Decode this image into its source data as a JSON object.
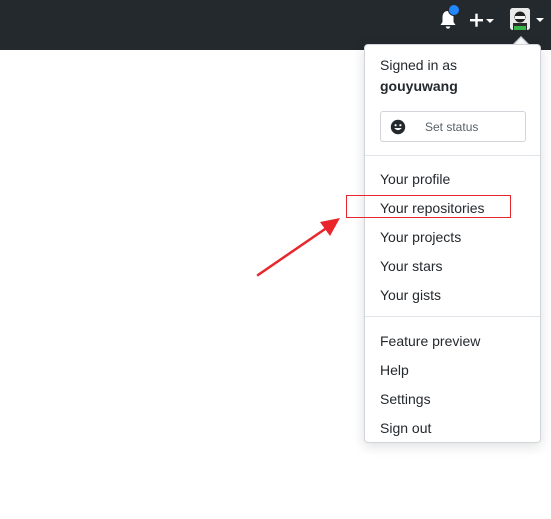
{
  "header": {
    "notifications_icon": "bell-icon",
    "notification_dot_color": "#2188ff",
    "new_icon": "plus-icon",
    "avatar_icon": "user-avatar-icon"
  },
  "dropdown": {
    "signed_in_label": "Signed in as",
    "username": "gouyuwang",
    "status_button": {
      "icon": "smiley-icon",
      "label": "Set status"
    },
    "section_one": [
      {
        "label": "Your profile"
      },
      {
        "label": "Your repositories"
      },
      {
        "label": "Your projects"
      },
      {
        "label": "Your stars"
      },
      {
        "label": "Your gists"
      }
    ],
    "section_two": [
      {
        "label": "Feature preview"
      },
      {
        "label": "Help"
      },
      {
        "label": "Settings"
      },
      {
        "label": "Sign out"
      }
    ]
  },
  "annotation": {
    "highlighted_item": "Your repositories",
    "color": "#e8262b"
  }
}
